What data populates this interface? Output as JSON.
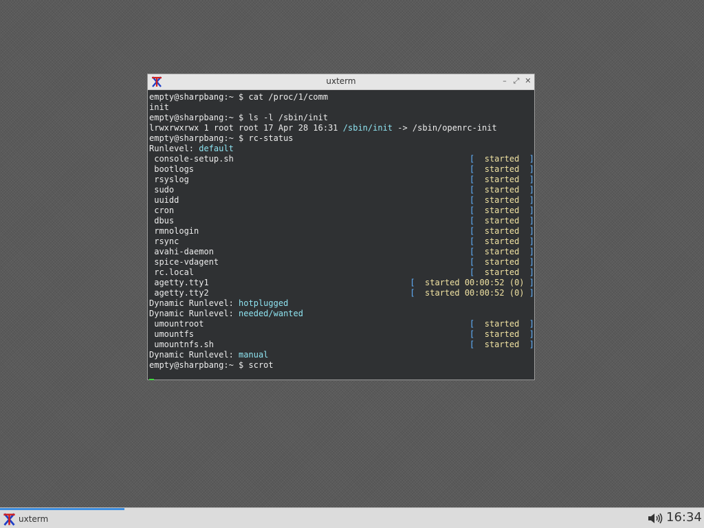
{
  "window": {
    "title": "uxterm",
    "icon": "xterm-logo-icon",
    "controls": {
      "minimize": "–",
      "maximize": "⤢",
      "close": "✕"
    }
  },
  "terminal": {
    "lines": [
      {
        "segments": [
          {
            "text": "empty@sharpbang:~ $ cat /proc/1/comm"
          }
        ]
      },
      {
        "segments": [
          {
            "text": "init"
          }
        ]
      },
      {
        "segments": [
          {
            "text": "empty@sharpbang:~ $ ls -l /sbin/init"
          }
        ]
      },
      {
        "segments": [
          {
            "text": "lrwxrwxrwx 1 root root 17 Apr 28 16:31 "
          },
          {
            "text": "/sbin/init",
            "cls": "cyan"
          },
          {
            "text": " -> /sbin/openrc-init"
          }
        ]
      },
      {
        "segments": [
          {
            "text": "empty@sharpbang:~ $ rc-status"
          }
        ]
      },
      {
        "segments": [
          {
            "text": "Runlevel: "
          },
          {
            "text": "default",
            "cls": "cyan"
          }
        ]
      },
      {
        "service": " console-setup.sh",
        "status": "started",
        "pad": "  "
      },
      {
        "service": " bootlogs",
        "status": "started",
        "pad": "  "
      },
      {
        "service": " rsyslog",
        "status": "started",
        "pad": "  "
      },
      {
        "service": " sudo",
        "status": "started",
        "pad": "  "
      },
      {
        "service": " uuidd",
        "status": "started",
        "pad": "  "
      },
      {
        "service": " cron",
        "status": "started",
        "pad": "  "
      },
      {
        "service": " dbus",
        "status": "started",
        "pad": "  "
      },
      {
        "service": " rmnologin",
        "status": "started",
        "pad": "  "
      },
      {
        "service": " rsync",
        "status": "started",
        "pad": "  "
      },
      {
        "service": " avahi-daemon",
        "status": "started",
        "pad": "  "
      },
      {
        "service": " spice-vdagent",
        "status": "started",
        "pad": "  "
      },
      {
        "service": " rc.local",
        "status": "started",
        "pad": "  "
      },
      {
        "service": " agetty.tty1",
        "status": "started 00:00:52 (0)",
        "pad": " "
      },
      {
        "service": " agetty.tty2",
        "status": "started 00:00:52 (0)",
        "pad": " "
      },
      {
        "segments": [
          {
            "text": "Dynamic Runlevel: "
          },
          {
            "text": "hotplugged",
            "cls": "cyan"
          }
        ]
      },
      {
        "segments": [
          {
            "text": "Dynamic Runlevel: "
          },
          {
            "text": "needed/wanted",
            "cls": "cyan"
          }
        ]
      },
      {
        "service": " umountroot",
        "status": "started",
        "pad": "  "
      },
      {
        "service": " umountfs",
        "status": "started",
        "pad": "  "
      },
      {
        "service": " umountnfs.sh",
        "status": "started",
        "pad": "  "
      },
      {
        "segments": [
          {
            "text": "Dynamic Runlevel: "
          },
          {
            "text": "manual",
            "cls": "cyan"
          }
        ]
      },
      {
        "segments": [
          {
            "text": "empty@sharpbang:~ $ scrot"
          }
        ]
      },
      {
        "cursor": true
      }
    ]
  },
  "taskbar": {
    "items": [
      {
        "label": "uxterm",
        "icon": "xterm-logo-icon",
        "active": true
      }
    ],
    "volume_icon": "speaker-icon",
    "clock": "16:34"
  },
  "colors": {
    "terminal_bg": "#2f3133",
    "terminal_fg": "#ececec",
    "cyan": "#8ee3f0",
    "bracket": "#63b2ff",
    "status_ok": "#f0e2a2",
    "cursor": "#3fdb3f",
    "accent": "#3d8ee0"
  }
}
